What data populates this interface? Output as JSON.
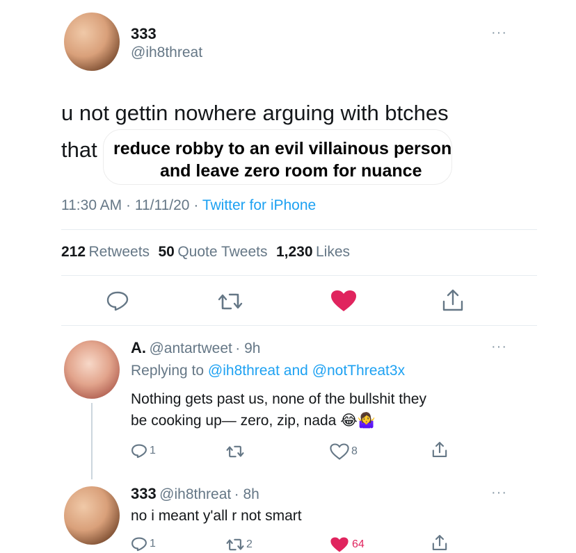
{
  "main_tweet": {
    "display_name": "333",
    "handle": "@ih8threat",
    "more": "···",
    "text_line1": "u not gettin nowhere arguing with btches",
    "text_line2_prefix": "that",
    "overlay_line1": "reduce robby to an evil villainous person",
    "overlay_line2": "and leave zero room for nuance",
    "time": "11:30 AM",
    "sep1": "·",
    "date": "11/11/20",
    "sep2": "·",
    "source": "Twitter for iPhone",
    "retweets_count": "212",
    "retweets_label": "Retweets",
    "quotes_count": "50",
    "quotes_label": "Quote Tweets",
    "likes_count": "1,230",
    "likes_label": "Likes",
    "liked": true,
    "like_color": "#e0245e"
  },
  "replies": [
    {
      "display_name": "A.",
      "handle": "@antartweet",
      "time": "· 9h",
      "more": "···",
      "replying_prefix": "Replying to",
      "replying_user1": "@ih8threat",
      "replying_and": "and",
      "replying_user2": "@notThreat3x",
      "text_line1": "Nothing gets past us, none of the bullshit they",
      "text_line2": "be cooking up— zero, zip, nada",
      "emoji": "😂🤷‍♀️",
      "reply_count": "1",
      "retweet_count": "",
      "like_count": "8",
      "liked": false
    },
    {
      "display_name": "333",
      "handle": "@ih8threat",
      "time": "· 8h",
      "more": "···",
      "text_line1": "no i meant y'all r not smart",
      "reply_count": "1",
      "retweet_count": "2",
      "like_count": "64",
      "liked": true
    }
  ],
  "colors": {
    "accent": "#1da1f2",
    "secondary_text": "#657786",
    "divider": "#e6ecf0",
    "like_red": "#e0245e"
  }
}
